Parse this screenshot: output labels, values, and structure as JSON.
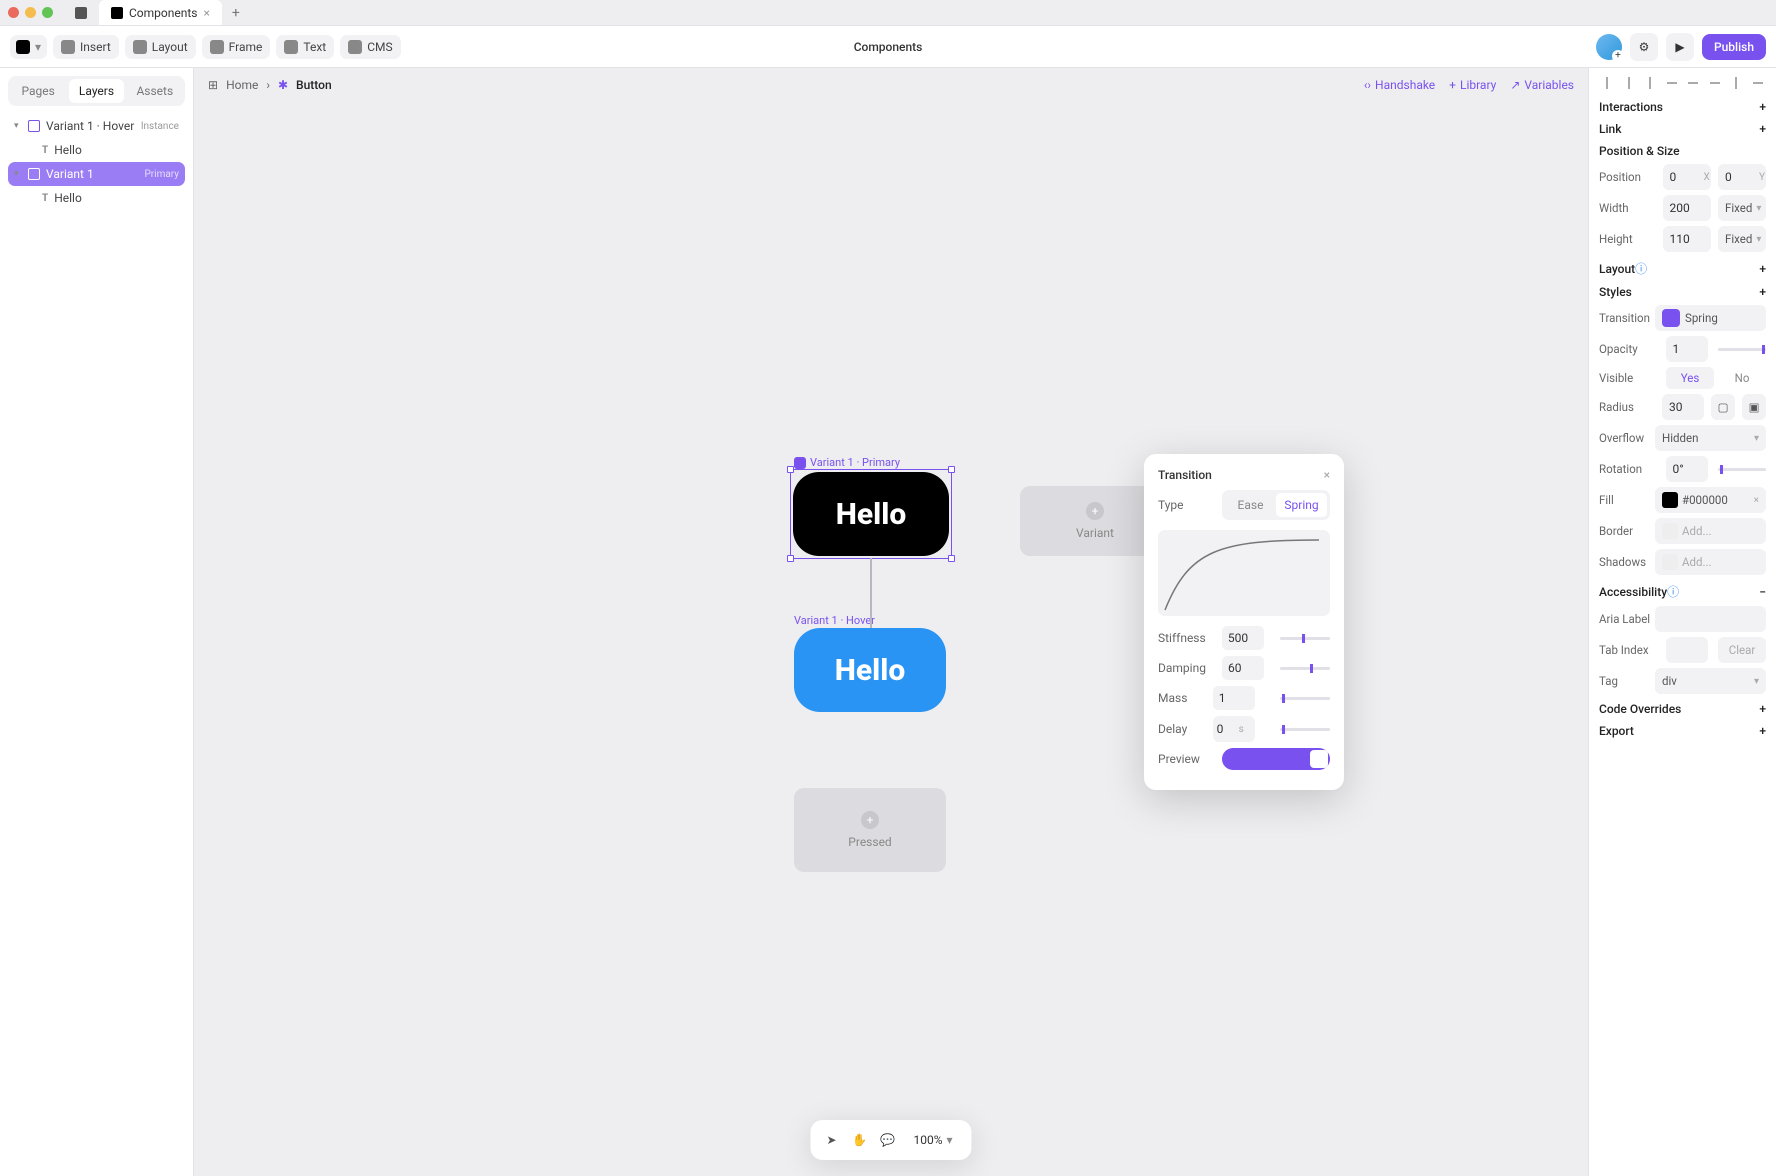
{
  "tabs": {
    "project": "",
    "current": "Components"
  },
  "toolbar": {
    "insert": "Insert",
    "layout": "Layout",
    "frame": "Frame",
    "text": "Text",
    "cms": "CMS",
    "title": "Components",
    "publish": "Publish"
  },
  "panel_tabs": {
    "pages": "Pages",
    "layers": "Layers",
    "assets": "Assets"
  },
  "tree": [
    {
      "label": "Variant 1 · Hover",
      "badge": "Instance"
    },
    {
      "label": "Hello"
    },
    {
      "label": "Variant 1",
      "badge": "Primary",
      "selected": true
    },
    {
      "label": "Hello"
    }
  ],
  "breadcrumbs": {
    "home": "Home",
    "current": "Button"
  },
  "canvas_links": {
    "handshake": "Handshake",
    "library": "Library",
    "variables": "Variables"
  },
  "canvas": {
    "primary_label": "Variant 1 · Primary",
    "primary_text": "Hello",
    "hover_label": "Variant 1 · Hover",
    "hover_text": "Hello",
    "variant_ph": "Variant",
    "pressed_ph": "Pressed"
  },
  "transition_popup": {
    "title": "Transition",
    "type_label": "Type",
    "ease": "Ease",
    "spring": "Spring",
    "stiffness_label": "Stiffness",
    "stiffness": "500",
    "damping_label": "Damping",
    "damping": "60",
    "mass_label": "Mass",
    "mass": "1",
    "delay_label": "Delay",
    "delay": "0",
    "preview_label": "Preview"
  },
  "props": {
    "interactions": "Interactions",
    "link": "Link",
    "pos_size": "Position & Size",
    "position": "Position",
    "pos_x": "0",
    "pos_y": "0",
    "width_l": "Width",
    "width": "200",
    "width_mode": "Fixed",
    "height_l": "Height",
    "height": "110",
    "height_mode": "Fixed",
    "layout": "Layout",
    "styles": "Styles",
    "transition": "Transition",
    "transition_v": "Spring",
    "opacity": "Opacity",
    "opacity_v": "1",
    "visible": "Visible",
    "yes": "Yes",
    "no": "No",
    "radius": "Radius",
    "radius_v": "30",
    "overflow": "Overflow",
    "overflow_v": "Hidden",
    "rotation": "Rotation",
    "rotation_v": "0°",
    "fill": "Fill",
    "fill_v": "#000000",
    "border": "Border",
    "border_v": "Add...",
    "shadows": "Shadows",
    "shadows_v": "Add...",
    "a11y": "Accessibility",
    "aria": "Aria Label",
    "tabindex": "Tab Index",
    "clear": "Clear",
    "tag": "Tag",
    "tag_v": "div",
    "code": "Code Overrides",
    "export": "Export"
  },
  "bottom": {
    "zoom": "100%"
  }
}
